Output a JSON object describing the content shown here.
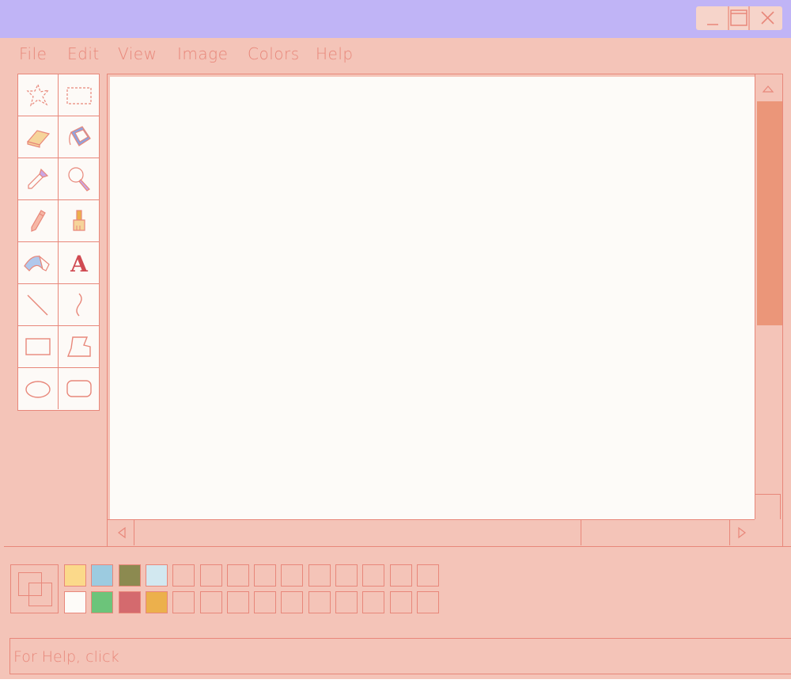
{
  "colors": {
    "titlebar": "#c0b4f6",
    "window_bg": "#f4c4b8",
    "line": "#e8877a",
    "canvas_bg": "#fdfbf8",
    "scroll_thumb": "#eb9679"
  },
  "window_controls": {
    "minimize_icon": "minimize-icon",
    "maximize_icon": "maximize-icon",
    "close_icon": "close-icon"
  },
  "menu": {
    "file": "File",
    "edit": "Edit",
    "view": "View",
    "image": "Image",
    "colors": "Colors",
    "help": "Help"
  },
  "tools": [
    {
      "icon": "free-form-select-icon"
    },
    {
      "icon": "rectangle-select-icon"
    },
    {
      "icon": "eraser-icon"
    },
    {
      "icon": "fill-bucket-icon"
    },
    {
      "icon": "color-picker-icon"
    },
    {
      "icon": "magnifier-icon"
    },
    {
      "icon": "pencil-icon"
    },
    {
      "icon": "brush-icon"
    },
    {
      "icon": "airbrush-icon"
    },
    {
      "icon": "text-tool-icon",
      "glyph": "A"
    },
    {
      "icon": "line-tool-icon"
    },
    {
      "icon": "curve-tool-icon"
    },
    {
      "icon": "rectangle-tool-icon"
    },
    {
      "icon": "polygon-tool-icon"
    },
    {
      "icon": "ellipse-tool-icon"
    },
    {
      "icon": "rounded-rectangle-tool-icon"
    }
  ],
  "palette": {
    "top_row": [
      "#fbd98a",
      "#9ccbe0",
      "#8c8a50",
      "#d2e8f0",
      "",
      "",
      "",
      "",
      "",
      "",
      "",
      "",
      "",
      ""
    ],
    "bottom_row": [
      "#fdfbf8",
      "#6cc47a",
      "#d46a6e",
      "#ecb04c",
      "",
      "",
      "",
      "",
      "",
      "",
      "",
      "",
      "",
      ""
    ]
  },
  "status": {
    "text": "For Help, click"
  }
}
